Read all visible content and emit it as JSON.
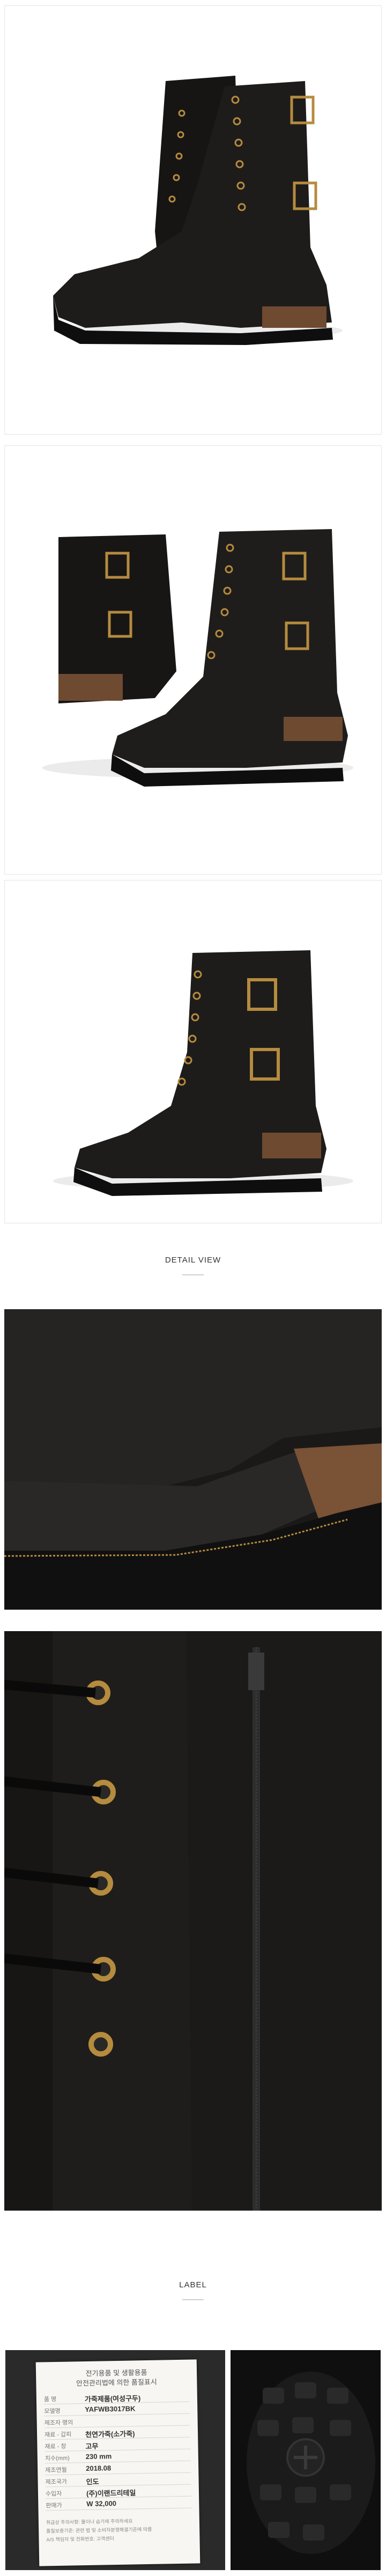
{
  "sections": {
    "detail_view": "DETAIL VIEW",
    "label": "LABEL"
  },
  "care_label": {
    "header_line1": "전기용품 및 생활용품",
    "header_line2": "안전관리법에 의한 품질표시",
    "rows": [
      {
        "key": "품    명",
        "value": "가죽제품(여성구두)"
      },
      {
        "key": "모델명",
        "value": "YAFWB3017BK"
      },
      {
        "key": "제조자 명의",
        "value": ""
      },
      {
        "key": "재료 - 갑피",
        "value": "천연가죽(소가죽)"
      },
      {
        "key": "재료 - 창",
        "value": "고무"
      },
      {
        "key": "치수(mm)",
        "value": "230 mm"
      },
      {
        "key": "제조연월",
        "value": "2018.08"
      },
      {
        "key": "제조국가",
        "value": "인도"
      },
      {
        "key": "수입자",
        "value": "(주)이랜드리테일"
      },
      {
        "key": "판매가",
        "value": "W 32,000"
      }
    ],
    "note_line1": "취급상 주의사항: 물이나 습기에 주의하세요",
    "note_line2": "품질보증기준: 관련 법 및 소비자분쟁해결기준에 따름",
    "note_line3": "A/S 책임자 및 전화번호: 고객센터"
  },
  "colors": {
    "leather": "#1b1a18",
    "sole": "#121212",
    "heel_wood": "#7a5236",
    "eyelet_gold": "#b58b3e"
  }
}
